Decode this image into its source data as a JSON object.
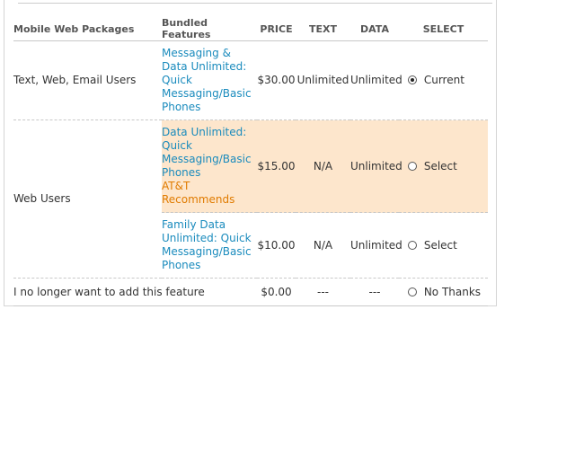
{
  "headers": {
    "package": "Mobile Web Packages",
    "features": "Bundled Features",
    "price": "PRICE",
    "text": "TEXT",
    "data": "DATA",
    "select": "SELECT"
  },
  "rows": [
    {
      "name": "Text, Web, Email Users",
      "feature_lines": [
        "Messaging &",
        "Data Unlimited:",
        "Quick",
        "Messaging/Basic",
        "Phones"
      ],
      "price": "$30.00",
      "text": "Unlimited",
      "data": "Unlimited",
      "select_label": "Current",
      "selected": true
    },
    {
      "name": "Web Users",
      "feature_lines": [
        "Data Unlimited:",
        "Quick",
        "Messaging/Basic",
        "Phones"
      ],
      "recommend_lines": [
        "AT&T",
        "Recommends"
      ],
      "price": "$15.00",
      "text": "N/A",
      "data": "Unlimited",
      "select_label": "Select",
      "selected": false
    },
    {
      "name": "",
      "feature_lines": [
        "Family Data",
        "Unlimited: Quick",
        "Messaging/Basic",
        "Phones"
      ],
      "price": "$10.00",
      "text": "N/A",
      "data": "Unlimited",
      "select_label": "Select",
      "selected": false
    },
    {
      "name": "I no longer want to add this feature",
      "price": "$0.00",
      "text": "---",
      "data": "---",
      "select_label": "No Thanks",
      "selected": false
    }
  ],
  "colors": {
    "link": "#1a8bbd",
    "recommend": "#e07b00",
    "highlight": "#fde6cc"
  }
}
